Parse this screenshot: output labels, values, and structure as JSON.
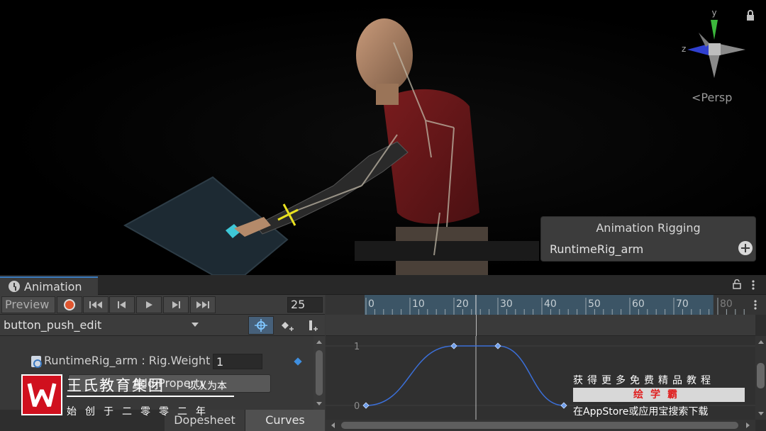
{
  "scene": {
    "gizmo": {
      "y_label": "y",
      "z_label": "z"
    },
    "projection_label": "<Persp",
    "rig_overlay": {
      "title": "Animation Rigging",
      "rig_name": "RuntimeRig_arm"
    }
  },
  "animation_window": {
    "tab_label": "Animation",
    "toolbar": {
      "preview_label": "Preview",
      "current_frame": "25"
    },
    "clip_name": "button_push_edit",
    "property": {
      "label": "RuntimeRig_arm : Rig.Weight",
      "value": "1"
    },
    "add_property_label": "Add Property",
    "view_tabs": {
      "dopesheet": "Dopesheet",
      "curves": "Curves"
    },
    "timeline": {
      "ticks": [
        "0",
        "10",
        "20",
        "30",
        "40",
        "50",
        "60",
        "70",
        "80"
      ],
      "visible_range_end_label": "80",
      "playhead_frame": 25
    },
    "curve": {
      "y_labels": [
        "1",
        "0"
      ],
      "keyframes": [
        {
          "frame": 0,
          "value": 0
        },
        {
          "frame": 20,
          "value": 1
        },
        {
          "frame": 30,
          "value": 1
        },
        {
          "frame": 45,
          "value": 0
        }
      ],
      "color": "#3b6fd8"
    }
  },
  "colors": {
    "accent": "#3a79bb",
    "record": "#e0562f",
    "timeline_highlight": "#3c5566"
  },
  "watermarks": {
    "brand": {
      "name": "王氏教育集团",
      "slogan": "以人为本",
      "founded": "始创于二零零二年"
    },
    "promo": {
      "top": "获得更多免费精品教程",
      "badge": "绘学霸",
      "bottom": "在AppStore或应用宝搜索下载"
    }
  }
}
